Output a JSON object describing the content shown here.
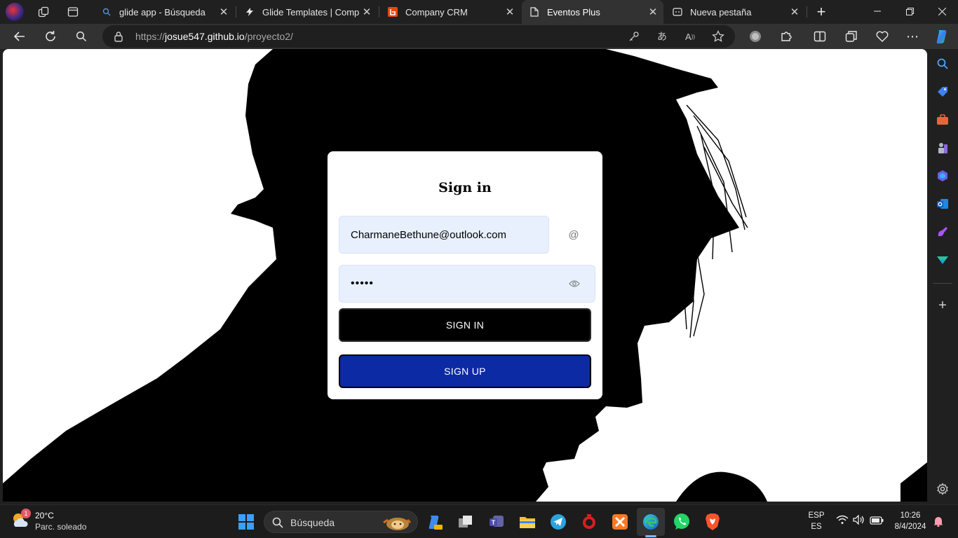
{
  "tabs": [
    {
      "title": "glide app - Búsqueda",
      "icon": "search-icon"
    },
    {
      "title": "Glide Templates | Company",
      "icon": "glide-logo-icon"
    },
    {
      "title": "Company CRM",
      "icon": "crm-app-icon"
    },
    {
      "title": "Eventos Plus",
      "icon": "page-icon",
      "active": true
    },
    {
      "title": "Nueva pestaña",
      "icon": "new-tab-page-icon"
    }
  ],
  "toolbar": {
    "url_scheme": "https://",
    "url_host": "josue547.github.io",
    "url_path": "/proyecto2/"
  },
  "page": {
    "title": "Sign in",
    "email_value": "CharmaneBethune@outlook.com",
    "password_value": "•••••",
    "email_icon": "@",
    "signin_label": "SIGN IN",
    "signup_label": "SIGN UP"
  },
  "taskbar": {
    "weather_temp": "20°C",
    "weather_desc": "Parc. soleado",
    "weather_badge": "1",
    "search_placeholder": "Búsqueda",
    "lang_1": "ESP",
    "lang_2": "ES",
    "time": "10:26",
    "date": "8/4/2024"
  },
  "colors": {
    "signin_button": "#000000",
    "signup_button": "#0b2aa3",
    "field_background": "#e8f0fe",
    "chrome_dark": "#202020",
    "toolbar": "#323232"
  }
}
